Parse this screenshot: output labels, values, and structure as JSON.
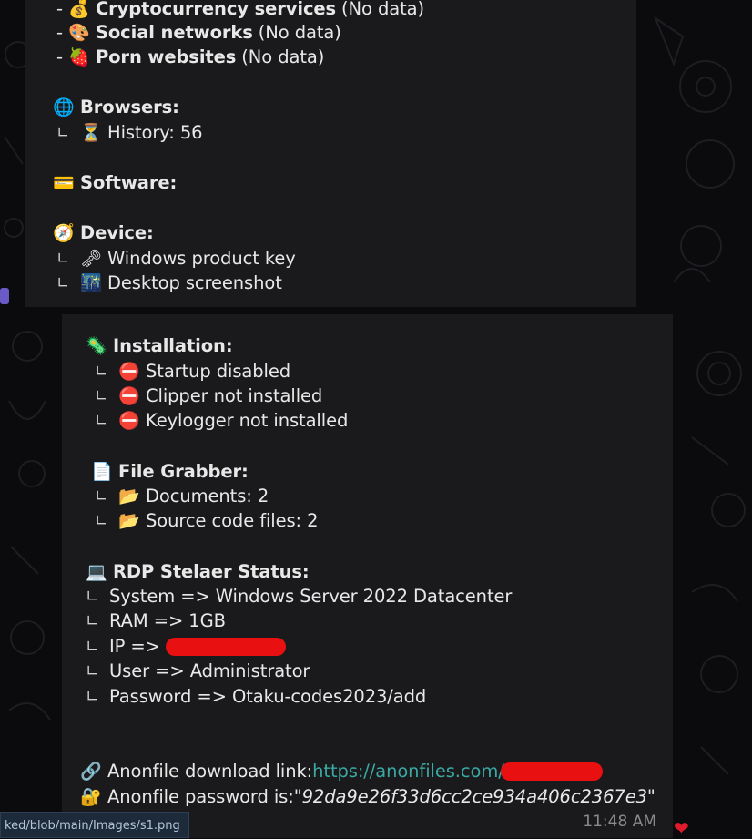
{
  "message1": {
    "lines": [
      {
        "bullet": "-",
        "icon": "money-bag-icon",
        "label": "Cryptocurrency services",
        "value": " (No data)"
      },
      {
        "bullet": "-",
        "icon": "palette-icon",
        "label": "Social networks",
        "value": " (No data)"
      },
      {
        "bullet": "-",
        "icon": "strawberry-icon",
        "label": "Porn websites",
        "value": " (No data)"
      }
    ],
    "browsers_title": "Browsers:",
    "browsers_items": [
      {
        "corner": "∟",
        "label": "History: 56"
      }
    ],
    "software_title": "Software:",
    "device_title": "Device:",
    "device_items": [
      {
        "corner": "∟",
        "label": "Windows product key"
      },
      {
        "corner": "∟",
        "label": "Desktop screenshot"
      }
    ]
  },
  "message2": {
    "installation_title": "Installation:",
    "installation_items": [
      {
        "corner": "∟",
        "label": "Startup disabled"
      },
      {
        "corner": "∟",
        "label": "Clipper not installed"
      },
      {
        "corner": "∟",
        "label": "Keylogger not installed"
      }
    ],
    "file_grabber_title": "File Grabber:",
    "file_grabber_items": [
      {
        "corner": "∟",
        "label": "Documents: 2"
      },
      {
        "corner": "∟",
        "label": "Source code files: 2"
      }
    ],
    "rdp_title": "RDP Stelaer Status:",
    "rdp_items": [
      {
        "corner": "∟",
        "label": "System => Windows Server 2022 Datacenter"
      },
      {
        "corner": "∟",
        "label": "RAM => 1GB"
      },
      {
        "corner": "∟",
        "label": "IP =>"
      },
      {
        "corner": "∟",
        "label": "User => Administrator"
      },
      {
        "corner": "∟",
        "label": "Password => Otaku-codes2023/add"
      }
    ],
    "anonfile_link_label": "Anonfile download link: ",
    "anonfile_link_url": "https://anonfiles.com/",
    "anonfile_password_label": "Anonfile password is: ",
    "anonfile_password_value": "\"92da9e26f33d6cc2ce934a406c2367e3\"",
    "time": "11:48 AM"
  },
  "statusbar_text": "ked/blob/main/Images/s1.png",
  "colors": {
    "bubble": "#1a1a1c",
    "link": "#3aa9a3",
    "redaction": "#e81010",
    "heart": "#e01b2b"
  }
}
